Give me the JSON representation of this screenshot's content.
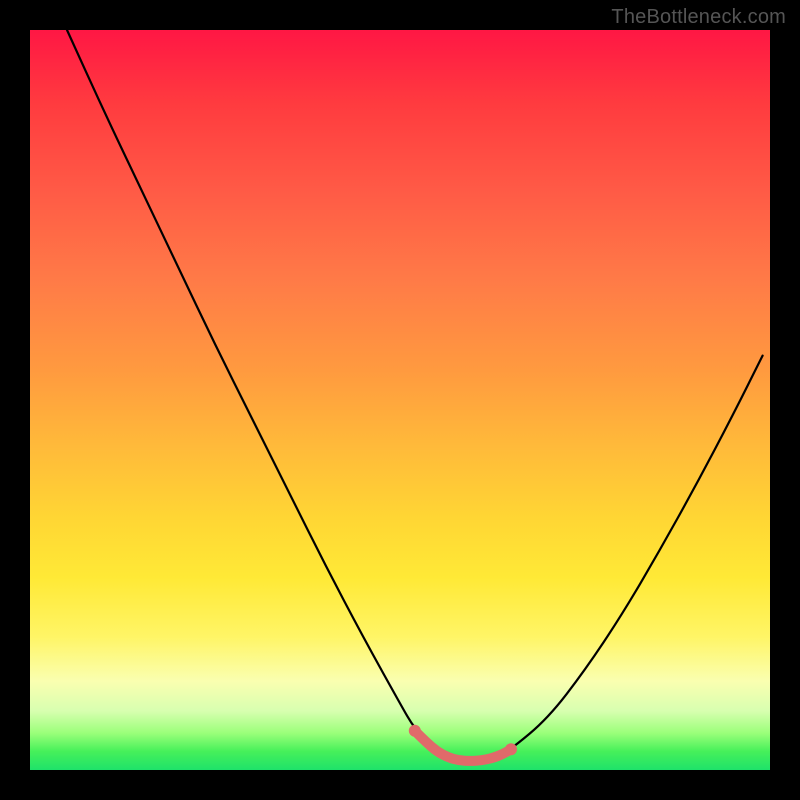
{
  "watermark": "TheBottleneck.com",
  "chart_data": {
    "type": "line",
    "title": "",
    "xlabel": "",
    "ylabel": "",
    "xlim": [
      0,
      100
    ],
    "ylim": [
      0,
      100
    ],
    "grid": false,
    "legend": false,
    "series": [
      {
        "name": "curve",
        "color": "#000000",
        "x": [
          5,
          10,
          15,
          20,
          25,
          30,
          35,
          40,
          45,
          50,
          52,
          55,
          58,
          61,
          63,
          65,
          70,
          75,
          80,
          85,
          90,
          95,
          99
        ],
        "values": [
          100,
          89,
          78.5,
          68,
          57.5,
          47.5,
          37.5,
          27.5,
          18,
          9,
          5.5,
          2.5,
          1.3,
          1.3,
          1.8,
          2.8,
          7,
          13.5,
          21,
          29.5,
          38.5,
          48,
          56
        ]
      },
      {
        "name": "highlight",
        "color": "#e06a6a",
        "x": [
          52,
          53.5,
          55,
          56.5,
          58,
          59.5,
          61,
          62.5,
          64,
          65
        ],
        "values": [
          5.3,
          3.8,
          2.5,
          1.7,
          1.3,
          1.2,
          1.3,
          1.6,
          2.2,
          2.8
        ]
      }
    ],
    "annotations": []
  }
}
